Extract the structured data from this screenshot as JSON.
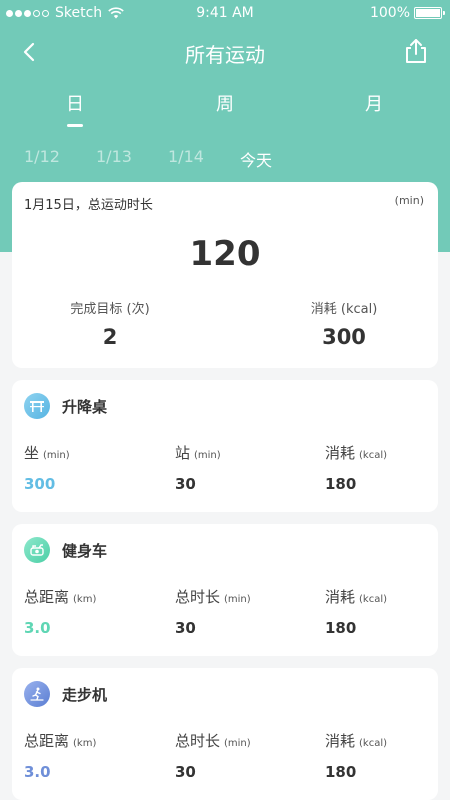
{
  "status_bar": {
    "carrier": "Sketch",
    "time": "9:41 AM",
    "battery": "100%"
  },
  "nav": {
    "title": "所有运动",
    "back_icon": "chevron-left-icon",
    "share_icon": "share-icon"
  },
  "period_tabs": [
    {
      "label": "日",
      "active": true
    },
    {
      "label": "周",
      "active": false
    },
    {
      "label": "月",
      "active": false
    }
  ],
  "dates": [
    {
      "label": "1/12",
      "active": false
    },
    {
      "label": "1/13",
      "active": false
    },
    {
      "label": "1/14",
      "active": false
    },
    {
      "label": "今天",
      "active": true
    }
  ],
  "summary": {
    "label": "1月15日，总运动时长",
    "unit": "(min)",
    "total": "120",
    "goal_label": "完成目标 (次)",
    "goal_value": "2",
    "calories_label": "消耗 (kcal)",
    "calories_value": "300"
  },
  "devices": [
    {
      "name": "升降桌",
      "icon": "standing-desk-icon",
      "accent": "#62bde4",
      "metrics": [
        {
          "label": "坐",
          "unit": "(min)",
          "value": "300"
        },
        {
          "label": "站",
          "unit": "(min)",
          "value": "30"
        },
        {
          "label": "消耗",
          "unit": "(kcal)",
          "value": "180"
        }
      ]
    },
    {
      "name": "健身车",
      "icon": "exercise-bike-icon",
      "accent": "#5fd6b4",
      "metrics": [
        {
          "label": "总距离",
          "unit": "(km)",
          "value": "3.0"
        },
        {
          "label": "总时长",
          "unit": "(min)",
          "value": "30"
        },
        {
          "label": "消耗",
          "unit": "(kcal)",
          "value": "180"
        }
      ]
    },
    {
      "name": "走步机",
      "icon": "treadmill-icon",
      "accent": "#6f8fd8",
      "metrics": [
        {
          "label": "总距离",
          "unit": "(km)",
          "value": "3.0"
        },
        {
          "label": "总时长",
          "unit": "(min)",
          "value": "30"
        },
        {
          "label": "消耗",
          "unit": "(kcal)",
          "value": "180"
        }
      ]
    }
  ]
}
